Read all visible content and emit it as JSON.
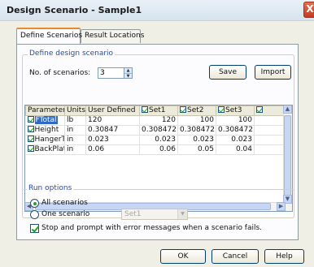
{
  "window": {
    "title": "Design Scenario - Sample1",
    "close_glyph": "X"
  },
  "tabs": [
    {
      "label": "Define Scenarios",
      "active": true
    },
    {
      "label": "Result Locations",
      "active": false
    }
  ],
  "design_group": {
    "title": "Define design scenario",
    "scenarios_label": "No. of scenarios:",
    "scenarios_value": "3",
    "save_label": "Save",
    "import_label": "Import"
  },
  "table": {
    "columns": [
      "Parameters",
      "Units",
      "User Defined",
      "Set1",
      "Set2",
      "Set3",
      ""
    ],
    "rows": [
      {
        "name": "FTotal",
        "units": "lb",
        "user": "120",
        "set1": "120",
        "set2": "100",
        "set3": "100"
      },
      {
        "name": "Height",
        "units": "in",
        "user": "0.30847",
        "set1": "0.308472",
        "set2": "0.308472",
        "set3": "0.308472"
      },
      {
        "name": "HangerTl",
        "units": "in",
        "user": "0.023",
        "set1": "0.023",
        "set2": "0.023",
        "set3": "0.023"
      },
      {
        "name": "BackPlate",
        "units": "in",
        "user": "0.06",
        "set1": "0.06",
        "set2": "0.05",
        "set3": "0.04"
      }
    ]
  },
  "run_group": {
    "title": "Run options",
    "all_label": "All scenarios",
    "one_label": "One scenario",
    "one_value": "Set1",
    "stop_label": "Stop and prompt with error messages when a scenario fails."
  },
  "footer": {
    "ok_label": "OK",
    "cancel_label": "Cancel",
    "help_label": "Help"
  },
  "colors": {
    "accent_tab": "#e68b2c",
    "group_title": "#1f4fb4",
    "check_green": "#21a121"
  }
}
